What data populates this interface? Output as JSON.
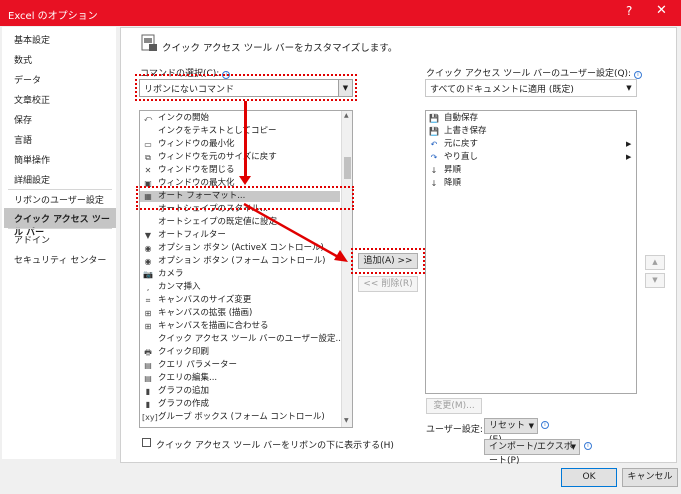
{
  "window": {
    "title": "Excel のオプション",
    "help": "?",
    "close": "✕"
  },
  "nav": {
    "items": [
      "基本設定",
      "数式",
      "データ",
      "文章校正",
      "保存",
      "言語",
      "簡単操作",
      "詳細設定",
      "リボンのユーザー設定",
      "クイック アクセス ツール バー",
      "アドイン",
      "セキュリティ センター"
    ],
    "selected_index": 9
  },
  "header": {
    "title": "クイック アクセス ツール バーをカスタマイズします。"
  },
  "commands": {
    "label": "コマンドの選択(C):",
    "selected": "リボンにないコマンド",
    "items": [
      {
        "icon": "⤺",
        "label": "インクの開始"
      },
      {
        "icon": "",
        "label": "インクをテキストとしてコピー"
      },
      {
        "icon": "▭",
        "label": "ウィンドウの最小化"
      },
      {
        "icon": "⧉",
        "label": "ウィンドウを元のサイズに戻す"
      },
      {
        "icon": "✕",
        "label": "ウィンドウを閉じる"
      },
      {
        "icon": "▣",
        "label": "ウィンドウの最大化"
      },
      {
        "icon": "▦",
        "label": "オート フォーマット..."
      },
      {
        "icon": "",
        "label": "オートシェイプのスタイル..."
      },
      {
        "icon": "",
        "label": "オートシェイプの既定値に設定"
      },
      {
        "icon": "▼",
        "label": "オートフィルター"
      },
      {
        "icon": "◉",
        "label": "オプション ボタン (ActiveX コントロール)"
      },
      {
        "icon": "◉",
        "label": "オプション ボタン (フォーム コントロール)"
      },
      {
        "icon": "📷",
        "label": "カメラ"
      },
      {
        "icon": "‚",
        "label": "カンマ挿入"
      },
      {
        "icon": "⌗",
        "label": "キャンバスのサイズ変更"
      },
      {
        "icon": "⊞",
        "label": "キャンバスの拡張 (描画)"
      },
      {
        "icon": "⊞",
        "label": "キャンバスを描画に合わせる"
      },
      {
        "icon": "",
        "label": "クイック アクセス ツール バーのユーザー設定..."
      },
      {
        "icon": "🖶",
        "label": "クイック印刷"
      },
      {
        "icon": "▤",
        "label": "クエリ パラメーター"
      },
      {
        "icon": "▤",
        "label": "クエリの編集..."
      },
      {
        "icon": "▮",
        "label": "グラフの追加"
      },
      {
        "icon": "▮",
        "label": "グラフの作成"
      },
      {
        "icon": "[xy]",
        "label": "グループ ボックス (フォーム コントロール)"
      }
    ],
    "selected_index": 6
  },
  "buttons": {
    "add": "追加(A) >>",
    "remove": "<< 削除(R)",
    "modify": "変更(M)...",
    "reset": "リセット(E)",
    "import_export": "インポート/エクスポート(P)",
    "ok": "OK",
    "cancel": "キャンセル",
    "up": "▲",
    "down": "▼"
  },
  "qat": {
    "label": "クイック アクセス ツール バーのユーザー設定(Q):",
    "selected": "すべてのドキュメントに適用 (既定)",
    "items": [
      {
        "icon": "💾",
        "label": "自動保存",
        "submenu": false
      },
      {
        "icon": "💾",
        "label": "上書き保存",
        "submenu": false
      },
      {
        "icon": "↶",
        "label": "元に戻す",
        "submenu": true
      },
      {
        "icon": "↷",
        "label": "やり直し",
        "submenu": true
      },
      {
        "icon": "↓",
        "label": "昇順",
        "submenu": false
      },
      {
        "icon": "↓",
        "label": "降順",
        "submenu": false
      }
    ],
    "user_settings_label": "ユーザー設定:"
  },
  "below_ribbon_checkbox": "クイック アクセス ツール バーをリボンの下に表示する(H)",
  "colors": {
    "accent": "#e81123",
    "highlight": "#e00000"
  }
}
